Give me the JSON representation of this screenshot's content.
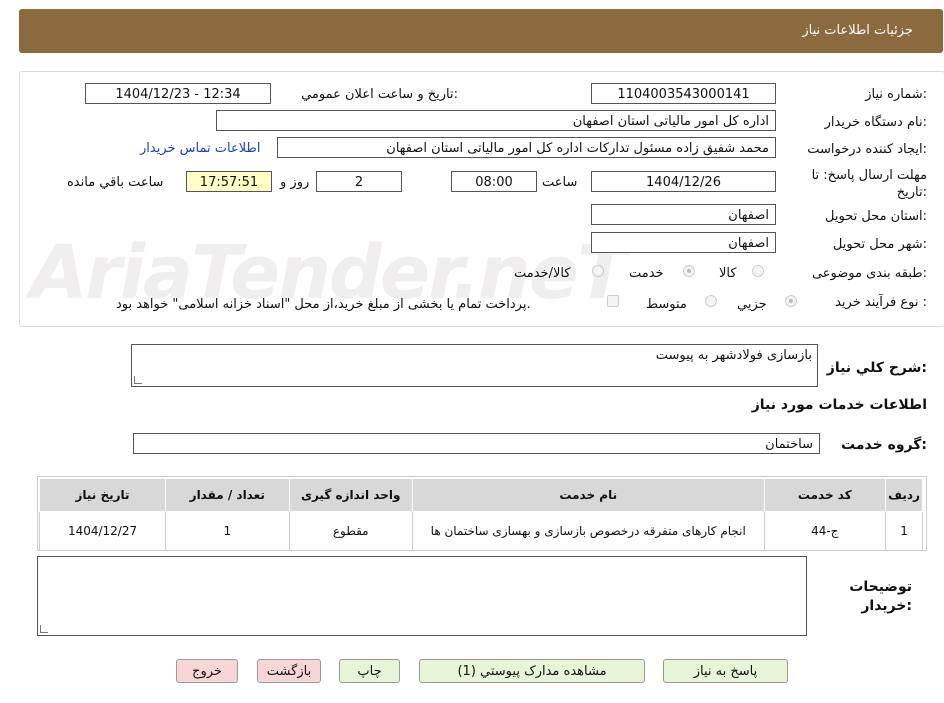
{
  "header": {
    "title": "جزئيات اطلاعات نیاز"
  },
  "watermark": "AriaTender.neT",
  "form": {
    "need_number_label": "شماره نیاز:",
    "need_number": "1104003543000141",
    "announce_label": "تاریخ و ساعت اعلان عمومي:",
    "announce_value": "1404/12/23 - 12:34",
    "buyer_org_label": "نام دستگاه خريدار:",
    "buyer_org": "اداره کل امور مالياتی استان اصفهان",
    "requester_label": "ايجاد کننده درخواست:",
    "requester": "محمد شفیق زاده مسئول تدارکات اداره کل امور مالياتی استان اصفهان",
    "contact_link": "اطلاعات تماس خريدار",
    "deadline_label": "مهلت ارسال پاسخ: تا تاريخ:",
    "deadline_date": "1404/12/26",
    "time_label": "ساعت",
    "deadline_time": "08:00",
    "days": "2",
    "days_label": "روز و",
    "remaining_time": "17:57:51",
    "remaining_label": "ساعت باقي مانده",
    "province_label": "استان محل تحویل:",
    "province": "اصفهان",
    "city_label": "شهر محل تحویل:",
    "city": "اصفهان",
    "category_label": "طبقه بندی موضوعی:",
    "category_options": [
      "کالا",
      "خدمت",
      "کالا/خدمت"
    ],
    "process_label": "نوع فرآیند خرید :",
    "process_options": [
      "جزيي",
      "متوسط"
    ],
    "payment_note": "پرداخت تمام یا بخشی از مبلغ خرید،از محل \"اسناد خزانه اسلامی\" خواهد بود."
  },
  "description": {
    "label": "شرح كلي نياز:",
    "value": "بازسازی فولادشهر به پیوست"
  },
  "services_title": "اطلاعات خدمات مورد نیاز",
  "service_group": {
    "label": "گروه خدمت:",
    "value": "ساختمان"
  },
  "table": {
    "headers": [
      "رديف",
      "کد خدمت",
      "نام خدمت",
      "واحد اندازه گیری",
      "تعداد / مقدار",
      "تاریخ نیاز"
    ],
    "rows": [
      {
        "index": "1",
        "code": "ج-44",
        "name": "انجام کارهای متفرقه درخصوص بازسازی و بهسازی ساختمان ها",
        "unit": "مقطوع",
        "qty": "1",
        "date": "1404/12/27"
      }
    ]
  },
  "buyer_notes": {
    "label": "توضيحات خريدار:",
    "value": ""
  },
  "buttons": {
    "reply": "پاسخ به نياز",
    "attachments": "مشاهده مدارک پیوستي (1)",
    "print": "چاپ",
    "back": "بازگشت",
    "exit": "خروج"
  }
}
